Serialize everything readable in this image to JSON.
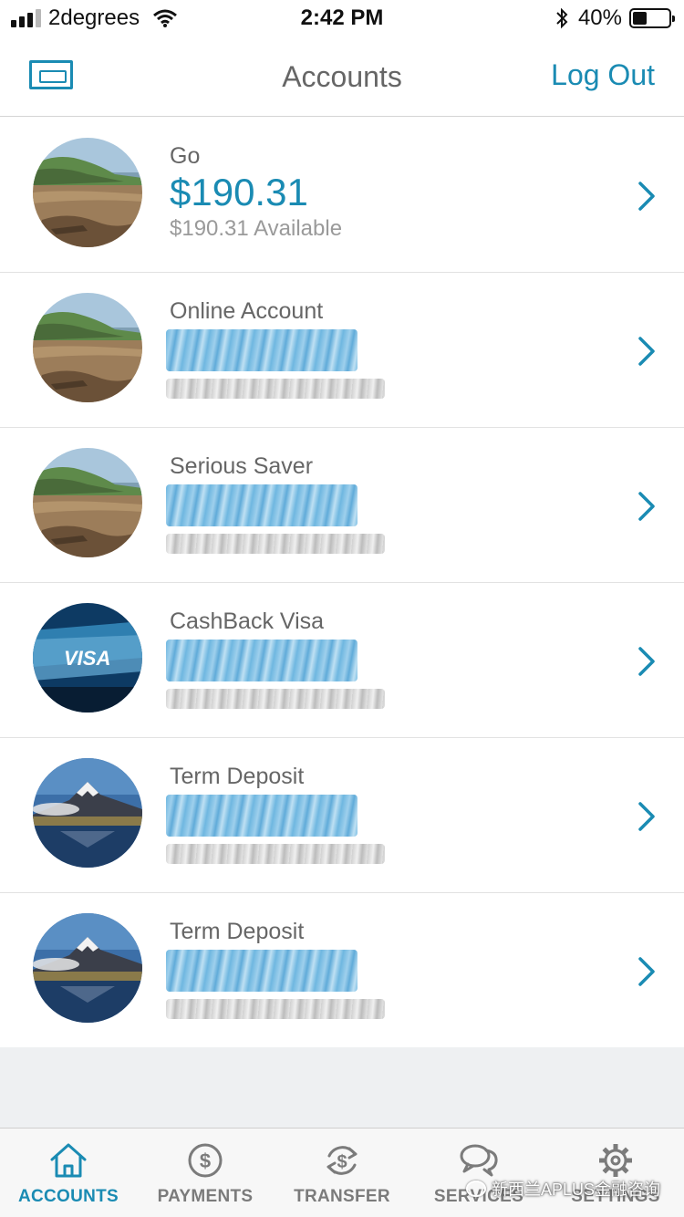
{
  "status_bar": {
    "carrier": "2degrees",
    "time": "2:42 PM",
    "battery_percent_text": "40%",
    "battery_level": 0.4
  },
  "nav": {
    "title": "Accounts",
    "logout_label": "Log Out",
    "left_icon": "card-icon",
    "accent_color": "#1a8bb3"
  },
  "accounts": [
    {
      "name": "Go",
      "balance": "$190.31",
      "available": "$190.31 Available",
      "image": "beach",
      "redacted": false
    },
    {
      "name": "Online Account",
      "balance": "",
      "available": "",
      "image": "beach",
      "redacted": true
    },
    {
      "name": "Serious Saver",
      "balance": "",
      "available": "",
      "image": "beach",
      "redacted": true
    },
    {
      "name": "CashBack Visa",
      "balance": "",
      "available": "",
      "image": "visa",
      "visa_label": "VISA",
      "redacted": true
    },
    {
      "name": "Term Deposit",
      "balance": "",
      "available": "",
      "image": "mountain",
      "redacted": true
    },
    {
      "name": "Term Deposit",
      "balance": "",
      "available": "",
      "image": "mountain",
      "redacted": true
    }
  ],
  "tabs": [
    {
      "label": "ACCOUNTS",
      "icon": "home-icon",
      "active": true
    },
    {
      "label": "PAYMENTS",
      "icon": "dollar-circle-icon",
      "active": false
    },
    {
      "label": "TRANSFER",
      "icon": "transfer-icon",
      "active": false
    },
    {
      "label": "SERVICES",
      "icon": "chat-bubbles-icon",
      "active": false
    },
    {
      "label": "SETTINGS",
      "icon": "gear-icon",
      "active": false
    }
  ],
  "watermark": {
    "text": "新西兰APLUS金融咨询"
  }
}
